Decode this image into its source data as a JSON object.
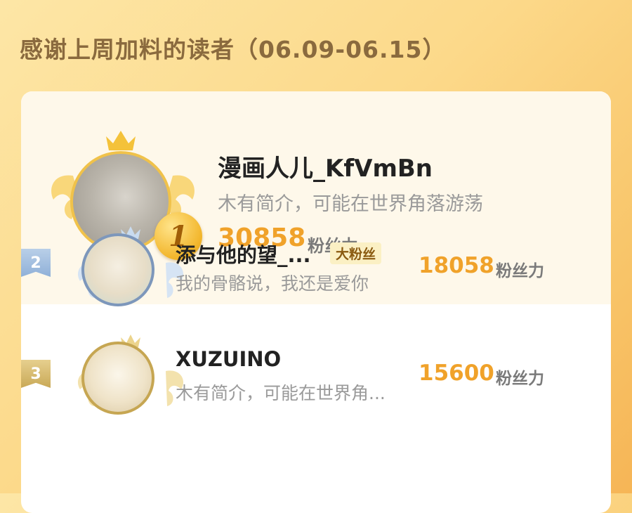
{
  "header": {
    "title": "感谢上周加料的读者（06.09-06.15）"
  },
  "colors": {
    "accent_score": "#f0a22a",
    "gold_ring": "#f0c24a",
    "silver_ring": "#7d97bb",
    "bronze_ring": "#c6a652"
  },
  "top_reader": {
    "rank": "1",
    "name": "漫画人儿_KfVmBn",
    "bio": "木有简介，可能在世界角落游荡",
    "score": "30858",
    "score_unit": "粉丝力",
    "icons": [
      "crown-icon",
      "wings-icon",
      "rank-medal-icon"
    ]
  },
  "readers": [
    {
      "rank": "2",
      "name": "添与他的望_...",
      "tag": "大粉丝",
      "bio": "我的骨骼说，我还是爱你",
      "score": "18058",
      "score_unit": "粉丝力"
    },
    {
      "rank": "3",
      "name": "XUZUINO",
      "bio": "木有简介，可能在世界角...",
      "score": "15600",
      "score_unit": "粉丝力"
    }
  ]
}
